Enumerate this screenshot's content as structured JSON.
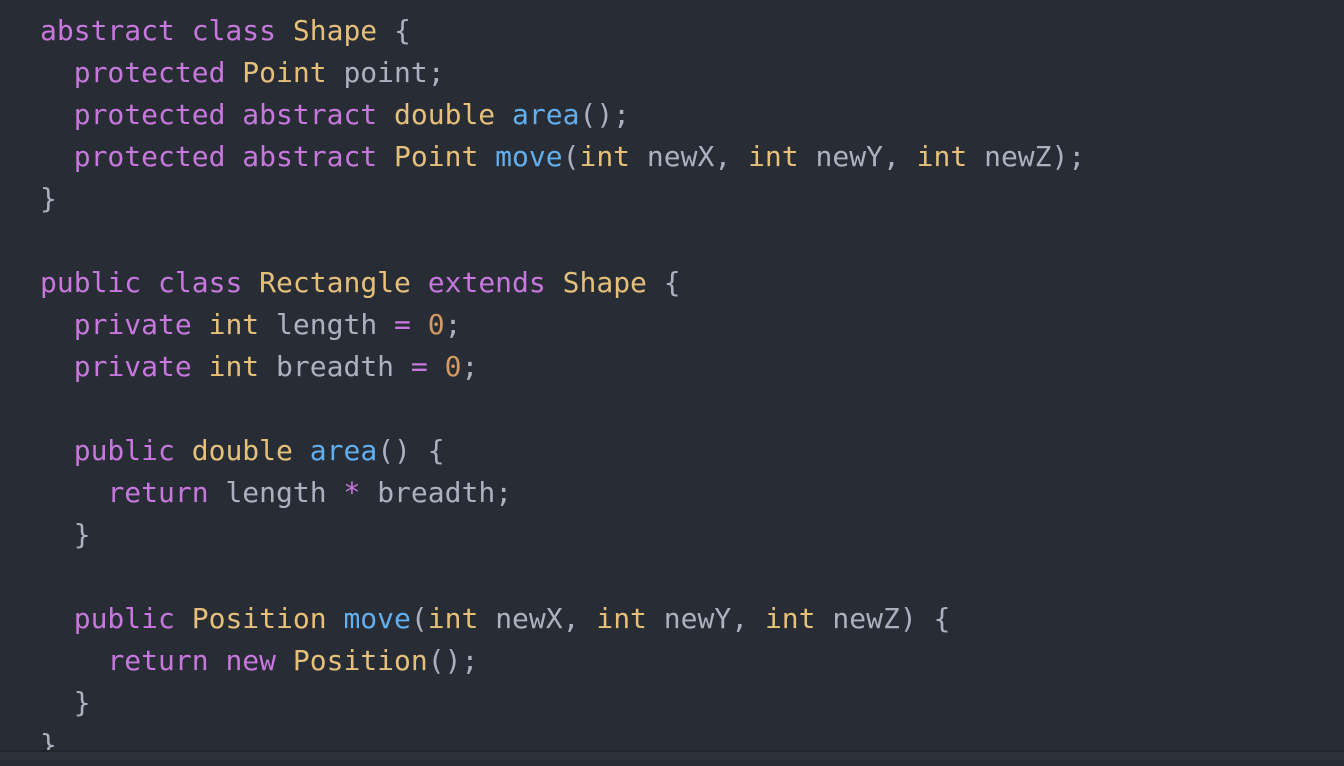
{
  "editor": {
    "language": "java",
    "theme": "one-dark",
    "background_color": "#282c34",
    "foreground_color": "#abb2bf",
    "font_size_px": 28,
    "line_height_px": 42,
    "palette": {
      "keyword": "#c678dd",
      "type": "#e5c07b",
      "function": "#61afef",
      "variable": "#abb2bf",
      "punctuation": "#abb2bf",
      "operator": "#c678dd",
      "number": "#d19a66"
    }
  },
  "code": {
    "lines": [
      {
        "index": 1,
        "text": "abstract class Shape {",
        "tokens": [
          {
            "t": "abstract",
            "k": "keyword"
          },
          {
            "t": " ",
            "k": "plain"
          },
          {
            "t": "class",
            "k": "keyword"
          },
          {
            "t": " ",
            "k": "plain"
          },
          {
            "t": "Shape",
            "k": "type"
          },
          {
            "t": " ",
            "k": "plain"
          },
          {
            "t": "{",
            "k": "punct"
          }
        ]
      },
      {
        "index": 2,
        "text": "  protected Point point;",
        "tokens": [
          {
            "t": "  ",
            "k": "plain"
          },
          {
            "t": "protected",
            "k": "keyword"
          },
          {
            "t": " ",
            "k": "plain"
          },
          {
            "t": "Point",
            "k": "type"
          },
          {
            "t": " ",
            "k": "plain"
          },
          {
            "t": "point",
            "k": "variable"
          },
          {
            "t": ";",
            "k": "punct"
          }
        ]
      },
      {
        "index": 3,
        "text": "  protected abstract double area();",
        "tokens": [
          {
            "t": "  ",
            "k": "plain"
          },
          {
            "t": "protected",
            "k": "keyword"
          },
          {
            "t": " ",
            "k": "plain"
          },
          {
            "t": "abstract",
            "k": "keyword"
          },
          {
            "t": " ",
            "k": "plain"
          },
          {
            "t": "double",
            "k": "type"
          },
          {
            "t": " ",
            "k": "plain"
          },
          {
            "t": "area",
            "k": "function"
          },
          {
            "t": "();",
            "k": "punct"
          }
        ]
      },
      {
        "index": 4,
        "text": "  protected abstract Point move(int newX, int newY, int newZ);",
        "tokens": [
          {
            "t": "  ",
            "k": "plain"
          },
          {
            "t": "protected",
            "k": "keyword"
          },
          {
            "t": " ",
            "k": "plain"
          },
          {
            "t": "abstract",
            "k": "keyword"
          },
          {
            "t": " ",
            "k": "plain"
          },
          {
            "t": "Point",
            "k": "type"
          },
          {
            "t": " ",
            "k": "plain"
          },
          {
            "t": "move",
            "k": "function"
          },
          {
            "t": "(",
            "k": "punct"
          },
          {
            "t": "int",
            "k": "type"
          },
          {
            "t": " ",
            "k": "plain"
          },
          {
            "t": "newX",
            "k": "variable"
          },
          {
            "t": ", ",
            "k": "punct"
          },
          {
            "t": "int",
            "k": "type"
          },
          {
            "t": " ",
            "k": "plain"
          },
          {
            "t": "newY",
            "k": "variable"
          },
          {
            "t": ", ",
            "k": "punct"
          },
          {
            "t": "int",
            "k": "type"
          },
          {
            "t": " ",
            "k": "plain"
          },
          {
            "t": "newZ",
            "k": "variable"
          },
          {
            "t": ");",
            "k": "punct"
          }
        ]
      },
      {
        "index": 5,
        "text": "}",
        "tokens": [
          {
            "t": "}",
            "k": "punct"
          }
        ]
      },
      {
        "index": 6,
        "text": "",
        "tokens": []
      },
      {
        "index": 7,
        "text": "public class Rectangle extends Shape {",
        "tokens": [
          {
            "t": "public",
            "k": "keyword"
          },
          {
            "t": " ",
            "k": "plain"
          },
          {
            "t": "class",
            "k": "keyword"
          },
          {
            "t": " ",
            "k": "plain"
          },
          {
            "t": "Rectangle",
            "k": "type"
          },
          {
            "t": " ",
            "k": "plain"
          },
          {
            "t": "extends",
            "k": "keyword"
          },
          {
            "t": " ",
            "k": "plain"
          },
          {
            "t": "Shape",
            "k": "type"
          },
          {
            "t": " ",
            "k": "plain"
          },
          {
            "t": "{",
            "k": "punct"
          }
        ]
      },
      {
        "index": 8,
        "text": "  private int length = 0;",
        "tokens": [
          {
            "t": "  ",
            "k": "plain"
          },
          {
            "t": "private",
            "k": "keyword"
          },
          {
            "t": " ",
            "k": "plain"
          },
          {
            "t": "int",
            "k": "type"
          },
          {
            "t": " ",
            "k": "plain"
          },
          {
            "t": "length",
            "k": "variable"
          },
          {
            "t": " ",
            "k": "plain"
          },
          {
            "t": "=",
            "k": "operator"
          },
          {
            "t": " ",
            "k": "plain"
          },
          {
            "t": "0",
            "k": "number"
          },
          {
            "t": ";",
            "k": "punct"
          }
        ]
      },
      {
        "index": 9,
        "text": "  private int breadth = 0;",
        "tokens": [
          {
            "t": "  ",
            "k": "plain"
          },
          {
            "t": "private",
            "k": "keyword"
          },
          {
            "t": " ",
            "k": "plain"
          },
          {
            "t": "int",
            "k": "type"
          },
          {
            "t": " ",
            "k": "plain"
          },
          {
            "t": "breadth",
            "k": "variable"
          },
          {
            "t": " ",
            "k": "plain"
          },
          {
            "t": "=",
            "k": "operator"
          },
          {
            "t": " ",
            "k": "plain"
          },
          {
            "t": "0",
            "k": "number"
          },
          {
            "t": ";",
            "k": "punct"
          }
        ]
      },
      {
        "index": 10,
        "text": "",
        "tokens": []
      },
      {
        "index": 11,
        "text": "  public double area() {",
        "tokens": [
          {
            "t": "  ",
            "k": "plain"
          },
          {
            "t": "public",
            "k": "keyword"
          },
          {
            "t": " ",
            "k": "plain"
          },
          {
            "t": "double",
            "k": "type"
          },
          {
            "t": " ",
            "k": "plain"
          },
          {
            "t": "area",
            "k": "function"
          },
          {
            "t": "() {",
            "k": "punct"
          }
        ]
      },
      {
        "index": 12,
        "text": "    return length * breadth;",
        "tokens": [
          {
            "t": "    ",
            "k": "plain"
          },
          {
            "t": "return",
            "k": "keyword"
          },
          {
            "t": " ",
            "k": "plain"
          },
          {
            "t": "length",
            "k": "variable"
          },
          {
            "t": " ",
            "k": "plain"
          },
          {
            "t": "*",
            "k": "operator"
          },
          {
            "t": " ",
            "k": "plain"
          },
          {
            "t": "breadth",
            "k": "variable"
          },
          {
            "t": ";",
            "k": "punct"
          }
        ]
      },
      {
        "index": 13,
        "text": "  }",
        "tokens": [
          {
            "t": "  ",
            "k": "plain"
          },
          {
            "t": "}",
            "k": "punct"
          }
        ]
      },
      {
        "index": 14,
        "text": "",
        "tokens": []
      },
      {
        "index": 15,
        "text": "  public Position move(int newX, int newY, int newZ) {",
        "tokens": [
          {
            "t": "  ",
            "k": "plain"
          },
          {
            "t": "public",
            "k": "keyword"
          },
          {
            "t": " ",
            "k": "plain"
          },
          {
            "t": "Position",
            "k": "type"
          },
          {
            "t": " ",
            "k": "plain"
          },
          {
            "t": "move",
            "k": "function"
          },
          {
            "t": "(",
            "k": "punct"
          },
          {
            "t": "int",
            "k": "type"
          },
          {
            "t": " ",
            "k": "plain"
          },
          {
            "t": "newX",
            "k": "variable"
          },
          {
            "t": ", ",
            "k": "punct"
          },
          {
            "t": "int",
            "k": "type"
          },
          {
            "t": " ",
            "k": "plain"
          },
          {
            "t": "newY",
            "k": "variable"
          },
          {
            "t": ", ",
            "k": "punct"
          },
          {
            "t": "int",
            "k": "type"
          },
          {
            "t": " ",
            "k": "plain"
          },
          {
            "t": "newZ",
            "k": "variable"
          },
          {
            "t": ") {",
            "k": "punct"
          }
        ]
      },
      {
        "index": 16,
        "text": "    return new Position();",
        "tokens": [
          {
            "t": "    ",
            "k": "plain"
          },
          {
            "t": "return",
            "k": "keyword"
          },
          {
            "t": " ",
            "k": "plain"
          },
          {
            "t": "new",
            "k": "keyword"
          },
          {
            "t": " ",
            "k": "plain"
          },
          {
            "t": "Position",
            "k": "type"
          },
          {
            "t": "();",
            "k": "punct"
          }
        ]
      },
      {
        "index": 17,
        "text": "  }",
        "tokens": [
          {
            "t": "  ",
            "k": "plain"
          },
          {
            "t": "}",
            "k": "punct"
          }
        ]
      },
      {
        "index": 18,
        "text": "}",
        "tokens": [
          {
            "t": "}",
            "k": "punct"
          }
        ]
      }
    ]
  }
}
